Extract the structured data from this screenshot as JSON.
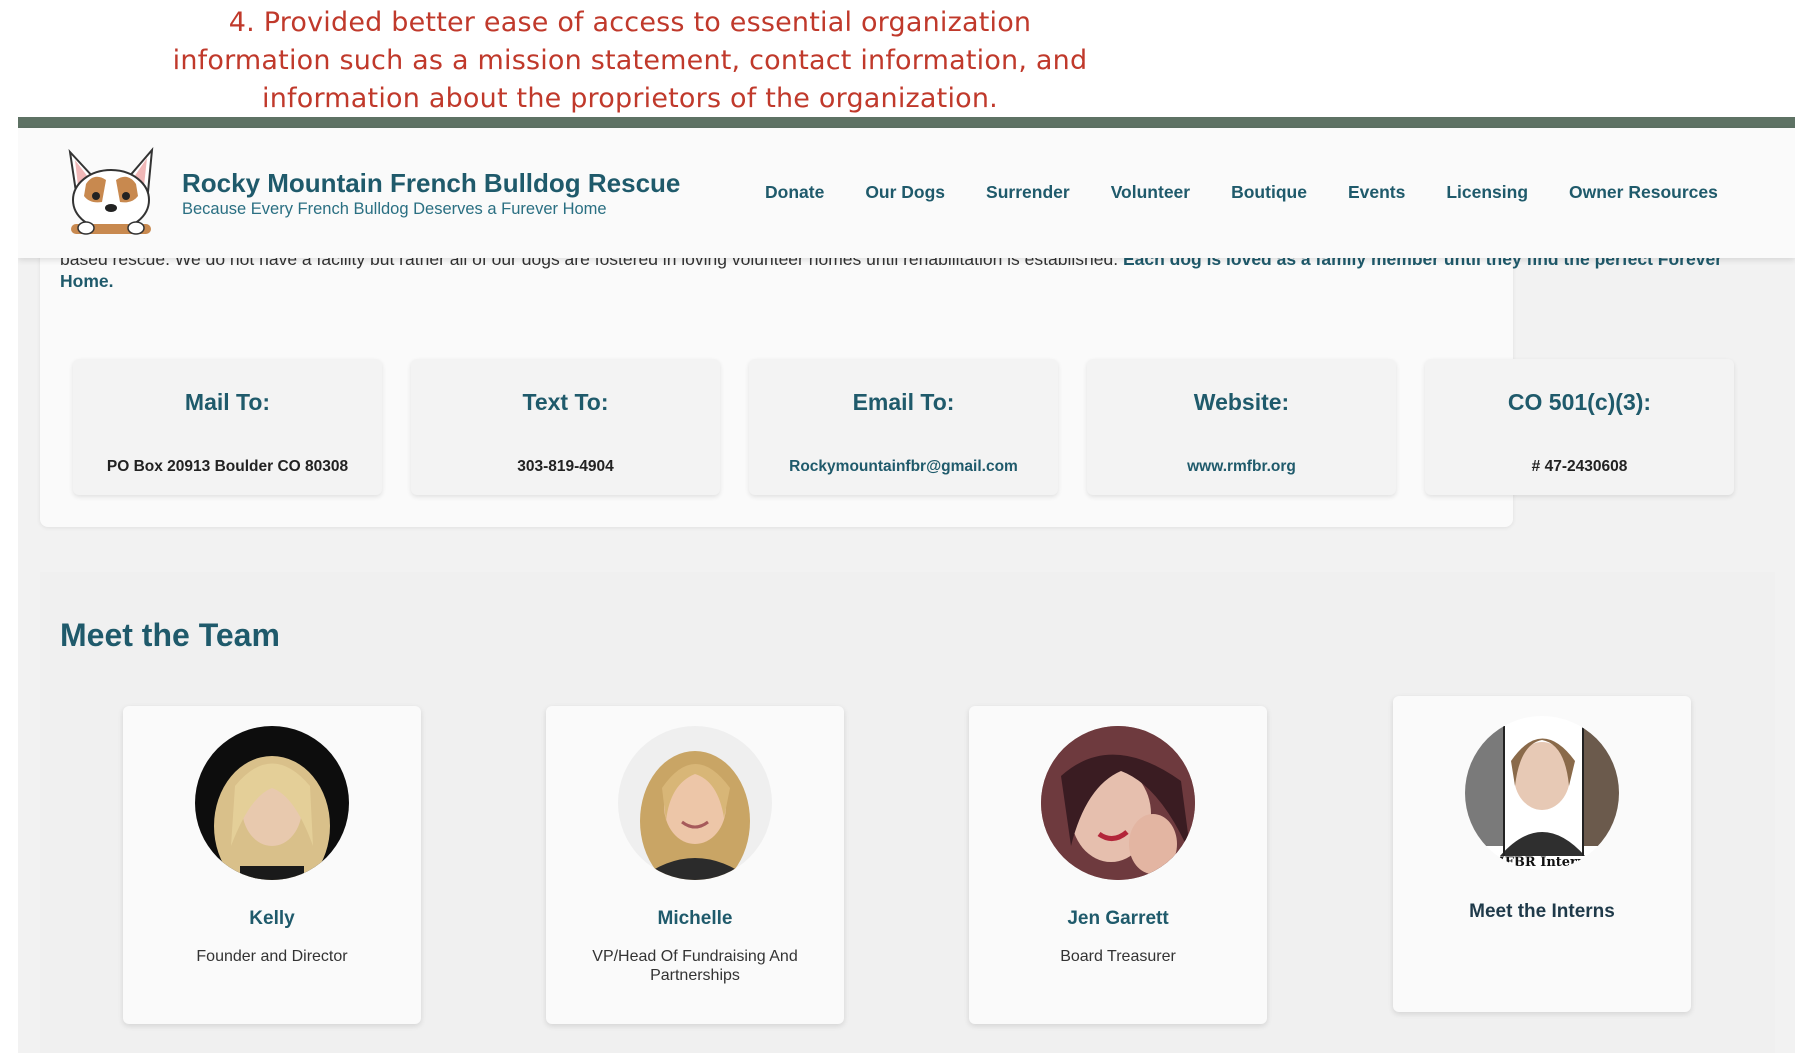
{
  "caption": {
    "line1": "4. Provided better ease of access to essential organization",
    "line2": "information such as a mission statement, contact information, and",
    "line3": "information about the proprietors of the organization."
  },
  "header": {
    "title": "Rocky Mountain French Bulldog Rescue",
    "tagline": "Because Every French Bulldog Deserves a Furever Home",
    "nav": [
      "Donate",
      "Our Dogs",
      "Surrender",
      "Volunteer",
      "Boutique",
      "Events",
      "Licensing",
      "Owner Resources"
    ]
  },
  "about": {
    "text_plain": "based rescue. We do not have a facility but rather all of our dogs are fostered in loving volunteer homes until rehabilitation is established.",
    "text_bold": "Each dog is loved as a family member until they find the perfect Forever Home."
  },
  "info": [
    {
      "label": "Mail To:",
      "value": "PO Box 20913 Boulder CO 80308"
    },
    {
      "label": "Text To:",
      "value": "303-819-4904"
    },
    {
      "label": "Email To:",
      "value": "Rockymountainfbr@gmail.com"
    },
    {
      "label": "Website:",
      "value": "www.rmfbr.org"
    },
    {
      "label": "CO 501(c)(3):",
      "value": "# 47-2430608"
    }
  ],
  "team": {
    "title": "Meet the Team",
    "members": [
      {
        "name": "Kelly",
        "role": "Founder and Director"
      },
      {
        "name": "Michelle",
        "role": "VP/Head Of Fundraising And Partnerships"
      },
      {
        "name": "Jen Garrett",
        "role": "Board Treasurer"
      },
      {
        "name": "Meet the Interns",
        "photo_text": "MFBR Interns"
      }
    ]
  }
}
